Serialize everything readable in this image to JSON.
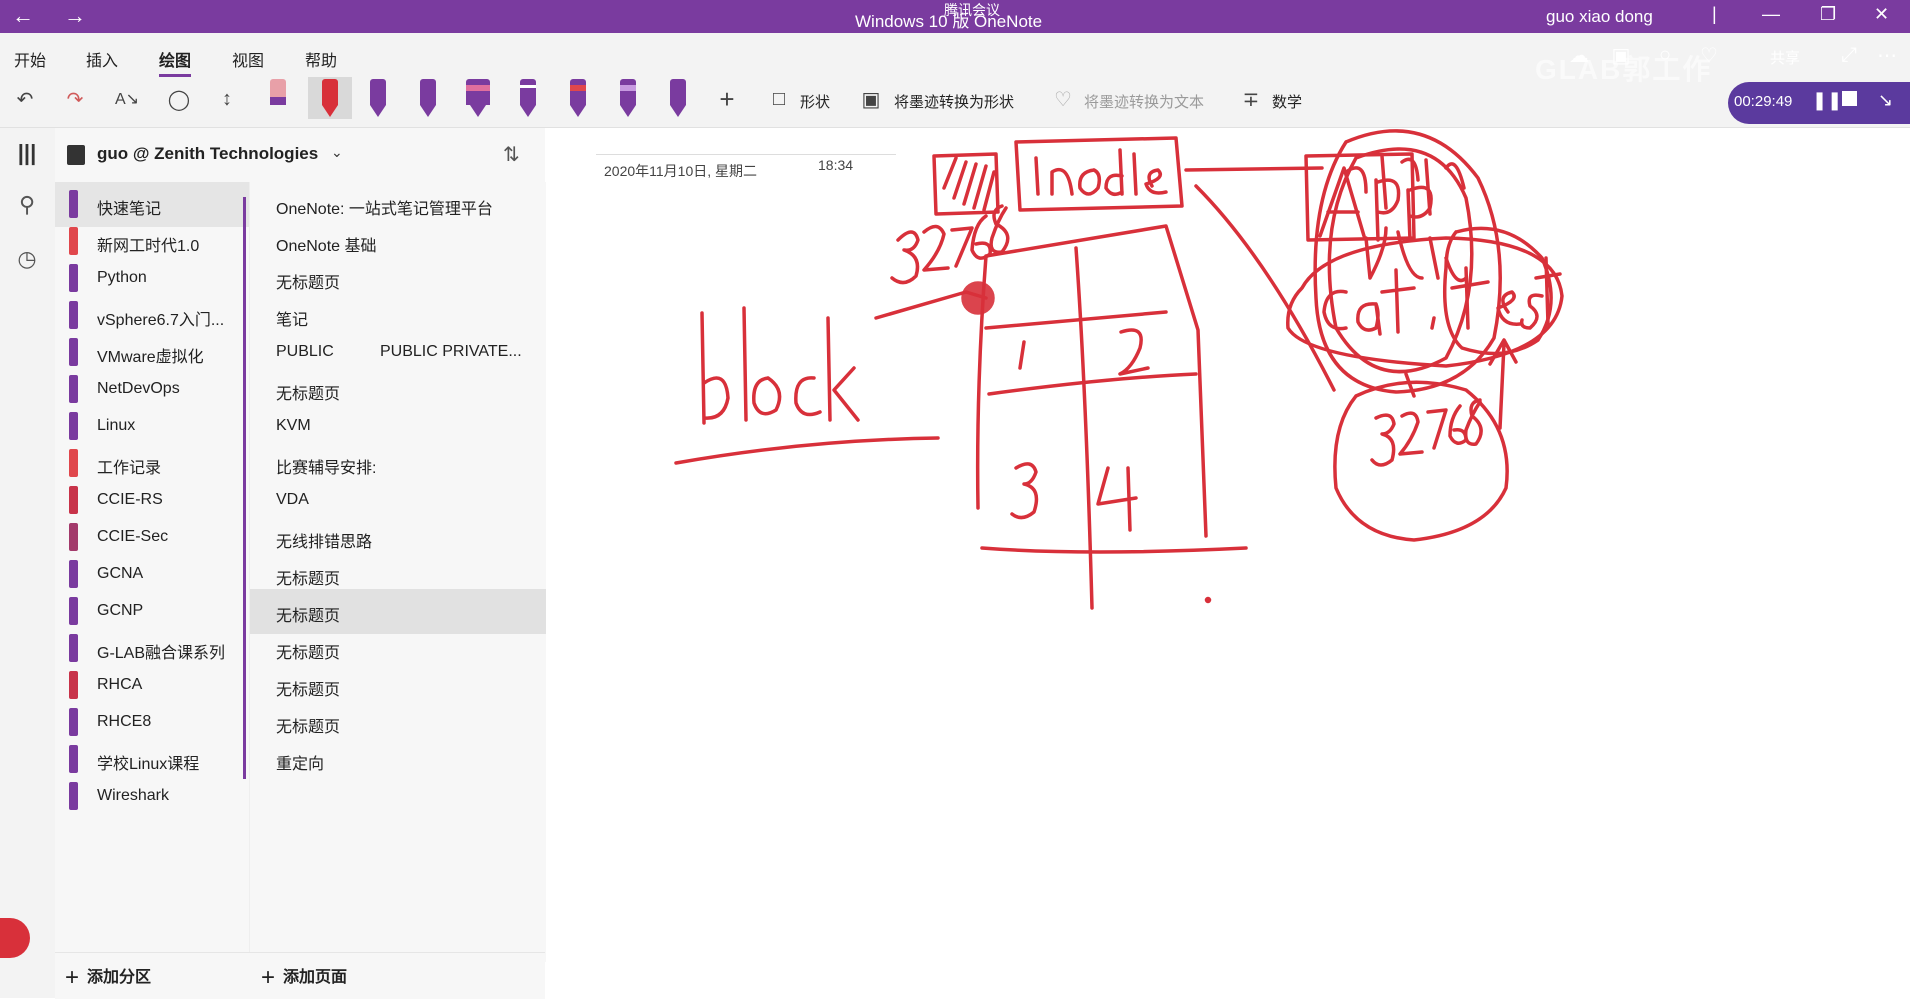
{
  "window": {
    "title": "Windows 10 版 OneNote",
    "meeting_label": "腾讯会议",
    "user": "guo xiao dong",
    "back_icon": "back-arrow-icon",
    "forward_icon": "forward-arrow-icon"
  },
  "ribbon": {
    "tabs": [
      "开始",
      "插入",
      "绘图",
      "视图",
      "帮助"
    ],
    "active_tab": "绘图",
    "shape_label": "形状",
    "ink_to_shape": "将墨迹转换为形状",
    "ink_to_text": "将墨迹转换为文本",
    "math": "数学",
    "share": "共享"
  },
  "recorder": {
    "time": "00:29:49",
    "watermark": "GLAB郭工作"
  },
  "notebook": {
    "name": "guo @ Zenith Technologies"
  },
  "sections": [
    {
      "label": "快速笔记",
      "color": "#7a3b9f"
    },
    {
      "label": "新网工时代1.0",
      "color": "#e0474c"
    },
    {
      "label": "Python",
      "color": "#7a3b9f"
    },
    {
      "label": "vSphere6.7入门...",
      "color": "#7a3b9f"
    },
    {
      "label": "VMware虚拟化",
      "color": "#7a3b9f"
    },
    {
      "label": "NetDevOps",
      "color": "#7a3b9f"
    },
    {
      "label": "Linux",
      "color": "#7a3b9f"
    },
    {
      "label": "工作记录",
      "color": "#e0474c"
    },
    {
      "label": "CCIE-RS",
      "color": "#c8334a"
    },
    {
      "label": "CCIE-Sec",
      "color": "#a33a6b"
    },
    {
      "label": "GCNA",
      "color": "#7a3b9f"
    },
    {
      "label": "GCNP",
      "color": "#7a3b9f"
    },
    {
      "label": "G-LAB融合课系列",
      "color": "#7a3b9f"
    },
    {
      "label": "RHCA",
      "color": "#c8334a"
    },
    {
      "label": "RHCE8",
      "color": "#7a3b9f"
    },
    {
      "label": "学校Linux课程",
      "color": "#7a3b9f"
    },
    {
      "label": "Wireshark",
      "color": "#7a3b9f"
    }
  ],
  "pages": [
    {
      "label": "OneNote: 一站式笔记管理平台"
    },
    {
      "label": "OneNote 基础"
    },
    {
      "label": "无标题页"
    },
    {
      "label": "笔记"
    },
    {
      "label": "PUBLIC",
      "label2": "PUBLIC PRIVATE..."
    },
    {
      "label": "无标题页"
    },
    {
      "label": "KVM"
    },
    {
      "label": "比赛辅导安排:"
    },
    {
      "label": "VDA"
    },
    {
      "label": "无线排错思路"
    },
    {
      "label": "无标题页"
    },
    {
      "label": "无标题页"
    },
    {
      "label": "无标题页"
    },
    {
      "label": "无标题页"
    },
    {
      "label": "无标题页"
    },
    {
      "label": "重定向"
    }
  ],
  "footer": {
    "add_section": "添加分区",
    "add_page": "添加页面"
  },
  "note": {
    "date": "2020年11月10日, 星期二",
    "time": "18:34"
  },
  "colors": {
    "accent": "#7a3b9f",
    "ink": "#d8303a"
  }
}
